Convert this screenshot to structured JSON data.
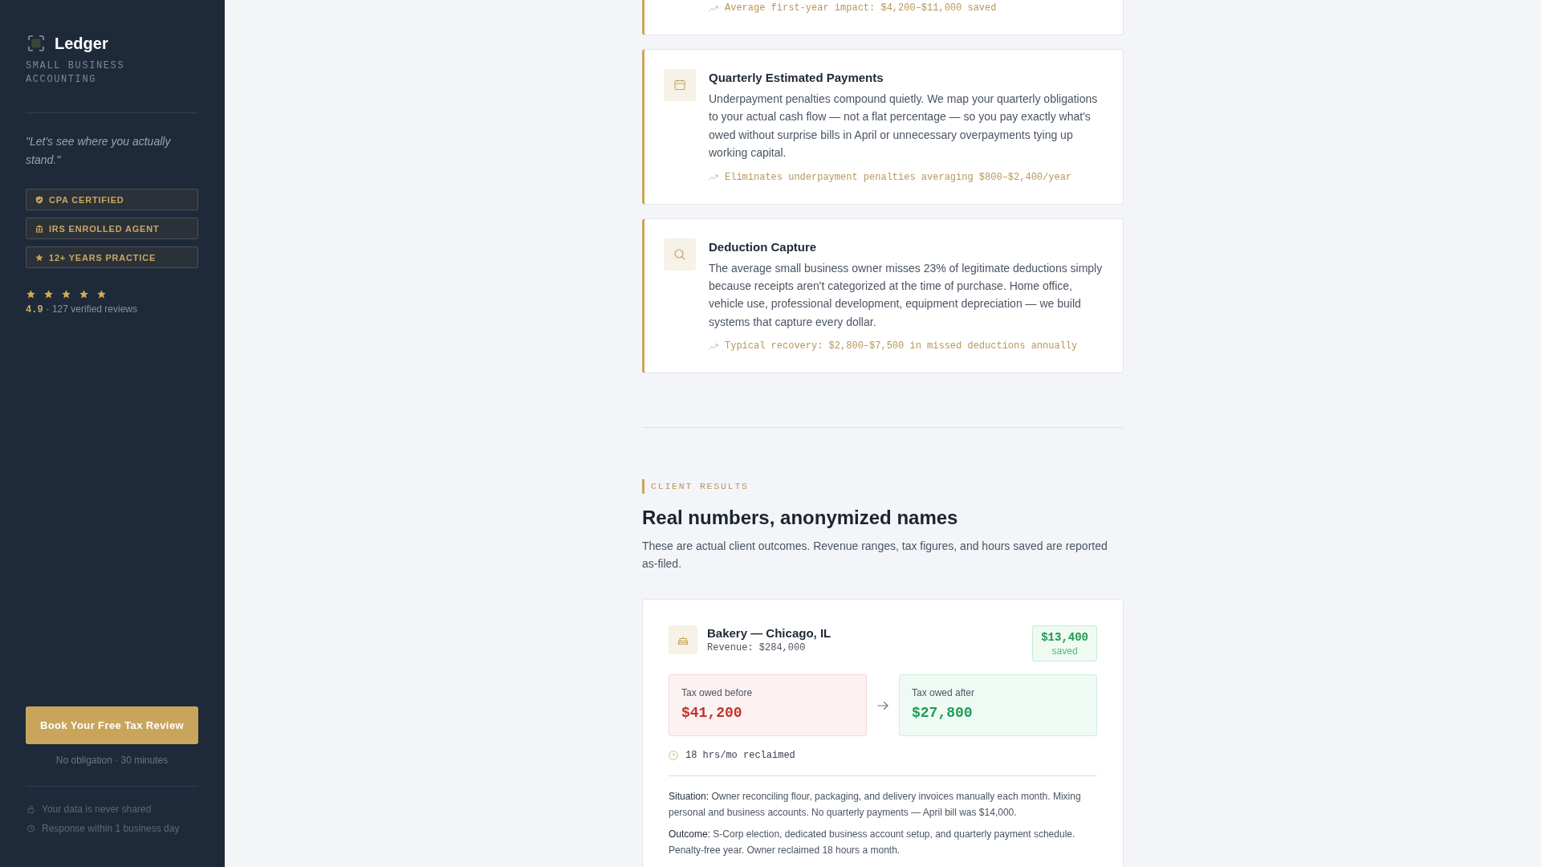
{
  "sidebar": {
    "brand": "Ledger",
    "tagline": "SMALL BUSINESS ACCOUNTING",
    "quote": "\"Let's see where you actually stand.\"",
    "badges": [
      "CPA CERTIFIED",
      "IRS ENROLLED AGENT",
      "12+ YEARS PRACTICE"
    ],
    "rating": {
      "stars": 5,
      "score": "4.9",
      "reviews": "· 127 verified reviews"
    },
    "cta": {
      "button": "Book Your Free Tax Review",
      "note": "No obligation · 30 minutes"
    },
    "assurances": [
      "Your data is never shared",
      "Response within 1 business day"
    ]
  },
  "services": [
    {
      "impact": "Average first-year impact: $4,200–$11,000 saved"
    },
    {
      "title": "Quarterly Estimated Payments",
      "body": "Underpayment penalties compound quietly. We map your quarterly obligations to your actual cash flow — not a flat percentage — so you pay exactly what's owed without surprise bills in April or unnecessary overpayments tying up working capital.",
      "impact": "Eliminates underpayment penalties averaging $800–$2,400/year"
    },
    {
      "title": "Deduction Capture",
      "body": "The average small business owner misses 23% of legitimate deductions simply because receipts aren't categorized at the time of purchase. Home office, vehicle use, professional development, equipment depreciation — we build systems that capture every dollar.",
      "impact": "Typical recovery: $2,800–$7,500 in missed deductions annually"
    }
  ],
  "client_results": {
    "eyebrow": "CLIENT RESULTS",
    "heading": "Real numbers, anonymized names",
    "intro": "These are actual client outcomes. Revenue ranges, tax figures, and hours saved are reported as-filed.",
    "cases": [
      {
        "name": "Bakery — Chicago, IL",
        "revenue": "Revenue: $284,000",
        "saved_amount": "$13,400",
        "saved_label": "saved",
        "before": {
          "label": "Tax owed before",
          "value": "$41,200"
        },
        "after": {
          "label": "Tax owed after",
          "value": "$27,800"
        },
        "hours": "18 hrs/mo reclaimed",
        "notes": [
          {
            "label": "Situation:",
            "text": "Owner reconciling flour, packaging, and delivery invoices manually each month. Mixing personal and business accounts. No quarterly payments — April bill was $14,000."
          },
          {
            "label": "Outcome:",
            "text": "S-Corp election, dedicated business account setup, and quarterly payment schedule. Penalty-free year. Owner reclaimed 18 hours a month."
          }
        ]
      }
    ]
  }
}
